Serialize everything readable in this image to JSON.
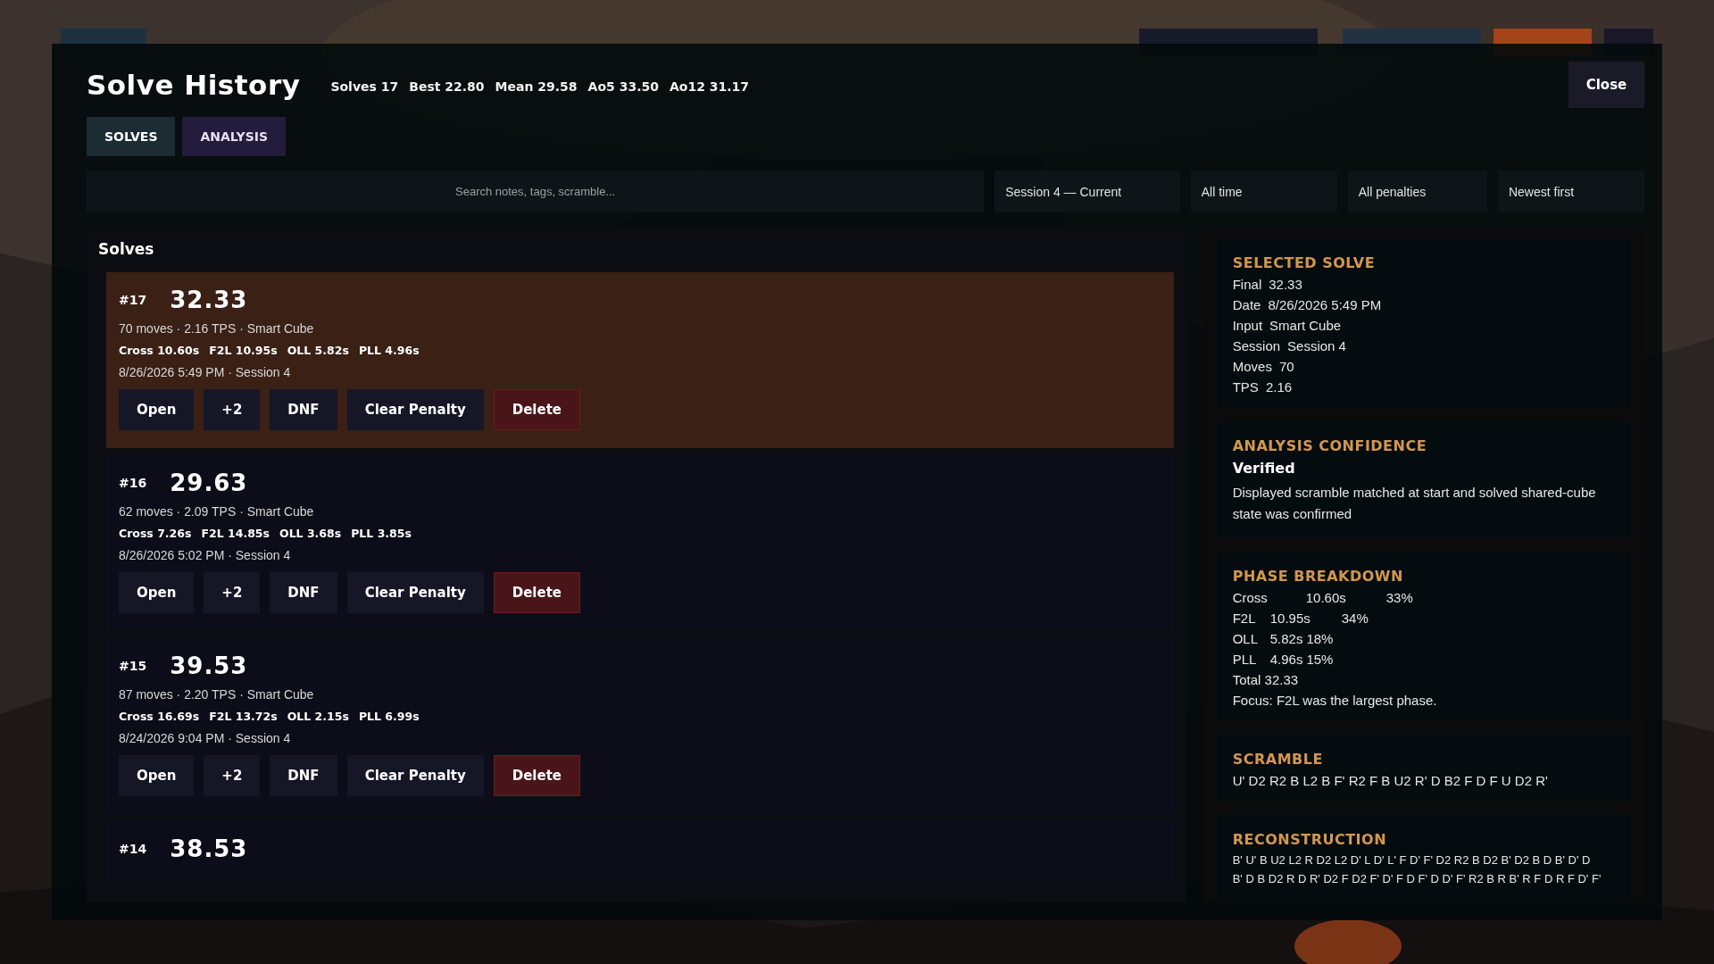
{
  "modal": {
    "title": "Solve History",
    "stats": [
      "Solves 17",
      "Best 22.80",
      "Mean 29.58",
      "Ao5 33.50",
      "Ao12 31.17"
    ],
    "close": "Close",
    "tabs": [
      {
        "label": "SOLVES",
        "selected": true
      },
      {
        "label": "ANALYSIS",
        "selected": false
      }
    ],
    "search": {
      "placeholder": "Search notes, tags, scramble..."
    },
    "filters": [
      "Session 4 — Current",
      "All time",
      "All penalties",
      "Newest first"
    ],
    "list_title": "Solves",
    "solves": [
      {
        "number": "#17",
        "time": "32.33",
        "meta": "70 moves · 2.16 TPS · Smart Cube",
        "phases": [
          "Cross 10.60s",
          "F2L 10.95s",
          "OLL 5.82s",
          "PLL 4.96s"
        ],
        "date": "8/26/2026 5:49 PM · Session 4",
        "selected": true,
        "actions": [
          "Open",
          "+2",
          "DNF",
          "Clear Penalty",
          "Delete"
        ]
      },
      {
        "number": "#16",
        "time": "29.63",
        "meta": "62 moves · 2.09 TPS · Smart Cube",
        "phases": [
          "Cross 7.26s",
          "F2L 14.85s",
          "OLL 3.68s",
          "PLL 3.85s"
        ],
        "date": "8/26/2026 5:02 PM · Session 4",
        "selected": false,
        "actions": [
          "Open",
          "+2",
          "DNF",
          "Clear Penalty",
          "Delete"
        ]
      },
      {
        "number": "#15",
        "time": "39.53",
        "meta": "87 moves · 2.20 TPS · Smart Cube",
        "phases": [
          "Cross 16.69s",
          "F2L 13.72s",
          "OLL 2.15s",
          "PLL 6.99s"
        ],
        "date": "8/24/2026 9:04 PM · Session 4",
        "selected": false,
        "actions": [
          "Open",
          "+2",
          "DNF",
          "Clear Penalty",
          "Delete"
        ]
      },
      {
        "number": "#14",
        "time": "38.53",
        "selected": false
      }
    ],
    "details": {
      "selected_solve": {
        "heading": "SELECTED SOLVE",
        "rows": [
          {
            "label": "Final",
            "value": "32.33"
          },
          {
            "label": "Date",
            "value": "8/26/2026 5:49 PM"
          },
          {
            "label": "Input",
            "value": "Smart Cube"
          },
          {
            "label": "Session",
            "value": "Session 4"
          },
          {
            "label": "Moves",
            "value": "70"
          },
          {
            "label": "TPS",
            "value": "2.16"
          }
        ]
      },
      "confidence": {
        "heading": "ANALYSIS CONFIDENCE",
        "status": "Verified",
        "text": "Displayed scramble matched at start and solved shared-cube state was confirmed"
      },
      "phase_breakdown": {
        "heading": "PHASE BREAKDOWN",
        "rows": [
          {
            "phase": "Cross",
            "time": "10.60s",
            "share": "33%"
          },
          {
            "phase": "F2L",
            "time": "10.95s",
            "share": "34%"
          },
          {
            "phase": "OLL",
            "time": "5.82s",
            "share": "18%"
          },
          {
            "phase": "PLL",
            "time": "4.96s",
            "share": "15%"
          }
        ],
        "total": "Total 32.33",
        "focus": "Focus: F2L was the largest phase."
      },
      "scramble": {
        "heading": "SCRAMBLE",
        "text": "U' D2 R2 B L2 B F' R2 F B U2 R' D B2 F D F U D2 R'"
      },
      "reconstruction": {
        "heading": "RECONSTRUCTION",
        "lines": [
          "B' U' B U2 L2 R D2 L2 D' L D' L' F D' F' D2 R2 B D2 B' D2 B D B' D' D",
          "B' D B D2 R D R' D2 F D2 F' D' F D F' D D' F' R2 B R B' R F D R F D' F'"
        ]
      }
    }
  }
}
